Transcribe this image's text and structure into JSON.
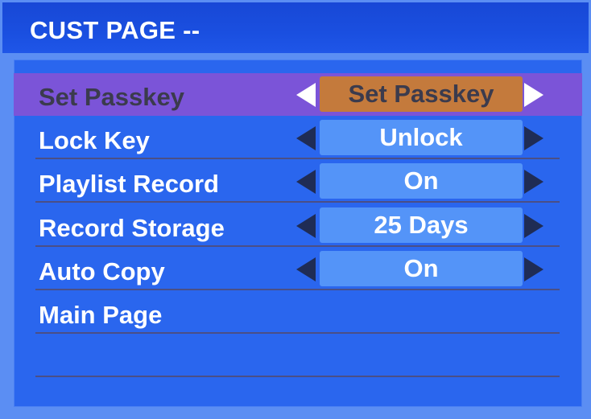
{
  "page": {
    "title": "CUST PAGE --"
  },
  "colors": {
    "title_bar": "#1a4fe0",
    "panel": "#2a66ee",
    "selected_row": "#7b54d8",
    "selected_value": "#c47a3c",
    "value_box": "#5494f8"
  },
  "menu": {
    "items": [
      {
        "label": "Set Passkey",
        "value": "Set Passkey",
        "selected": true
      },
      {
        "label": "Lock Key",
        "value": "Unlock"
      },
      {
        "label": "Playlist Record",
        "value": "On"
      },
      {
        "label": "Record Storage",
        "value": "25 Days"
      },
      {
        "label": "Auto Copy",
        "value": "On"
      },
      {
        "label": "Main Page"
      }
    ]
  },
  "icons": {
    "left": "triangle-left-icon",
    "right": "triangle-right-icon"
  }
}
